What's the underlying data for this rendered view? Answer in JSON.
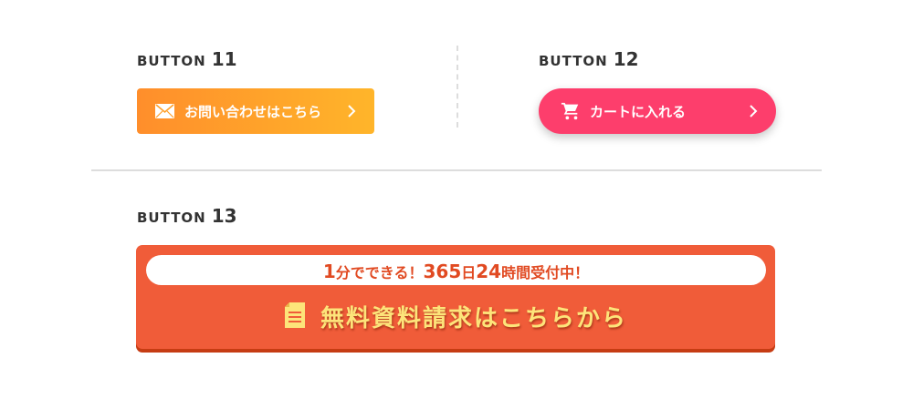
{
  "section_labels": {
    "b11": {
      "word": "BUTTON",
      "num": "11"
    },
    "b12": {
      "word": "BUTTON",
      "num": "12"
    },
    "b13": {
      "word": "BUTTON",
      "num": "13"
    }
  },
  "button11": {
    "label": "お問い合わせはこちら",
    "icon": "mail-icon",
    "color_start": "#ff8e2b",
    "color_end": "#ffb52a"
  },
  "button12": {
    "label": "カートに入れる",
    "icon": "cart-icon",
    "color": "#fd3e6c"
  },
  "button13": {
    "sub_label": {
      "p1": "1",
      "p2": "分でできる！",
      "p3": "365",
      "p4": "日",
      "p5": "24",
      "p6": "時間受付中！"
    },
    "label": "無料資料請求はこちらから",
    "icon": "document-icon",
    "color": "#f05c39",
    "text_color": "#fde47a"
  }
}
